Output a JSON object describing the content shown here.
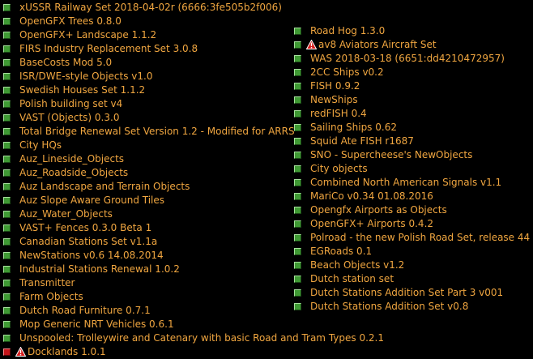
{
  "colors": {
    "text": "#f0a640",
    "status_ok": "#3f9a34",
    "status_error": "#c4141a",
    "background": "#000000"
  },
  "left_column": [
    {
      "label": "xUSSR Railway Set 2018-04-02r (6666:3fe505b2f006)",
      "status": "ok"
    },
    {
      "label": "OpenGFX Trees 0.8.0",
      "status": "ok"
    },
    {
      "label": "OpenGFX+ Landscape 1.1.2",
      "status": "ok"
    },
    {
      "label": "FIRS Industry Replacement Set 3.0.8",
      "status": "ok"
    },
    {
      "label": "BaseCosts Mod 5.0",
      "status": "ok"
    },
    {
      "label": "ISR/DWE-style Objects v1.0",
      "status": "ok"
    },
    {
      "label": "Swedish Houses Set 1.1.2",
      "status": "ok"
    },
    {
      "label": "Polish building set v4",
      "status": "ok"
    },
    {
      "label": "VAST (Objects) 0.3.0",
      "status": "ok"
    },
    {
      "label": "Total Bridge Renewal Set Version 1.2 - Modified for ARRS",
      "status": "ok"
    },
    {
      "label": "City HQs",
      "status": "ok"
    },
    {
      "label": "Auz_Lineside_Objects",
      "status": "ok"
    },
    {
      "label": "Auz_Roadside_Objects",
      "status": "ok"
    },
    {
      "label": "Auz Landscape and Terrain Objects",
      "status": "ok"
    },
    {
      "label": "Auz Slope Aware Ground Tiles",
      "status": "ok"
    },
    {
      "label": "Auz_Water_Objects",
      "status": "ok"
    },
    {
      "label": "VAST+ Fences 0.3.0 Beta 1",
      "status": "ok"
    },
    {
      "label": "Canadian Stations Set v1.1a",
      "status": "ok"
    },
    {
      "label": "NewStations v0.6 14.08.2014",
      "status": "ok"
    },
    {
      "label": "Industrial Stations Renewal 1.0.2",
      "status": "ok"
    },
    {
      "label": "Transmitter",
      "status": "ok"
    },
    {
      "label": "Farm Objects",
      "status": "ok"
    },
    {
      "label": "Dutch Road Furniture 0.7.1",
      "status": "ok"
    },
    {
      "label": "Mop Generic NRT Vehicles 0.6.1",
      "status": "ok"
    },
    {
      "label": " Unspooled: Trolleywire and Catenary with basic Road and Tram Types 0.2.1",
      "status": "ok"
    },
    {
      "label": "Docklands 1.0.1",
      "status": "error",
      "warning": true
    }
  ],
  "right_column": [
    {
      "label": "Road Hog 1.3.0",
      "status": "ok"
    },
    {
      "label": "av8 Aviators Aircraft Set",
      "status": "ok",
      "warning": true
    },
    {
      "label": "WAS 2018-03-18 (6651:dd4210472957)",
      "status": "ok"
    },
    {
      "label": "2CC Ships v0.2",
      "status": "ok"
    },
    {
      "label": "FISH 0.9.2",
      "status": "ok"
    },
    {
      "label": "NewShips",
      "status": "ok"
    },
    {
      "label": "redFISH 0.4",
      "status": "ok"
    },
    {
      "label": "  Sailing Ships  0.62",
      "status": "ok"
    },
    {
      "label": "Squid Ate FISH r1687",
      "status": "ok"
    },
    {
      "label": "SNO - Supercheese's NewObjects",
      "status": "ok"
    },
    {
      "label": "City objects",
      "status": "ok"
    },
    {
      "label": "Combined North American Signals v1.1",
      "status": "ok"
    },
    {
      "label": "MariCo v0.34 01.08.2016",
      "status": "ok"
    },
    {
      "label": "Opengfx Airports as Objects",
      "status": "ok"
    },
    {
      "label": "OpenGFX+ Airports 0.4.2",
      "status": "ok"
    },
    {
      "label": "Polroad - the new Polish Road Set, release 44",
      "status": "ok"
    },
    {
      "label": " EGRoads 0.1",
      "status": "ok"
    },
    {
      "label": "Beach Objects v1.2",
      "status": "ok"
    },
    {
      "label": "Dutch station set",
      "status": "ok"
    },
    {
      "label": "Dutch Stations Addition Set Part 3 v001",
      "status": "ok"
    },
    {
      "label": "Dutch Stations Addition Set v0.8",
      "status": "ok"
    }
  ]
}
